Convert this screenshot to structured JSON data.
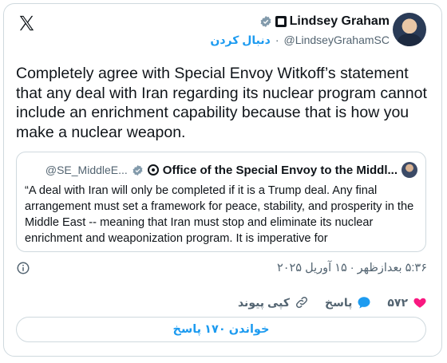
{
  "author": {
    "name": "Lindsey Graham",
    "handle": "@LindseyGrahamSC",
    "follow_label": "دنبال کردن"
  },
  "tweet": {
    "text": "Completely agree with Special Envoy Witkoff’s statement that any deal with Iran regarding its nuclear program cannot include an enrichment capability because that is how you make a nuclear weapon."
  },
  "quote": {
    "name": "Office of the Special Envoy to the Middl...",
    "handle": "@SE_MiddleE...",
    "text": "“A deal with Iran will only be completed if it is a Trump deal. Any final arrangement must set a framework for peace, stability, and prosperity in the Middle East -- meaning that Iran must stop and eliminate its nuclear enrichment and weaponization program. It is imperative for"
  },
  "meta": {
    "time": "۵:۳۶ بعدازظهر · ۱۵ آوریل ۲۰۲۵"
  },
  "actions": {
    "likes": "۵۷۲",
    "reply_label": "پاسخ",
    "copy_link_label": "کپی پیوند"
  },
  "read_replies": "خواندن ۱۷۰ پاسخ",
  "colors": {
    "accent": "#1d9bf0",
    "heart": "#f91880",
    "border": "#cfd9de"
  }
}
